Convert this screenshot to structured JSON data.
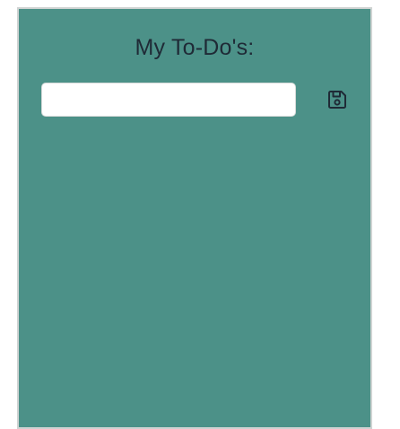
{
  "app": {
    "title": "My To-Do's:"
  },
  "todo_form": {
    "input_value": "",
    "save_icon": "floppy-disk-icon"
  },
  "colors": {
    "panel_background": "#4c9188",
    "title_text": "#1f2a36",
    "icon": "#1f2a36"
  }
}
